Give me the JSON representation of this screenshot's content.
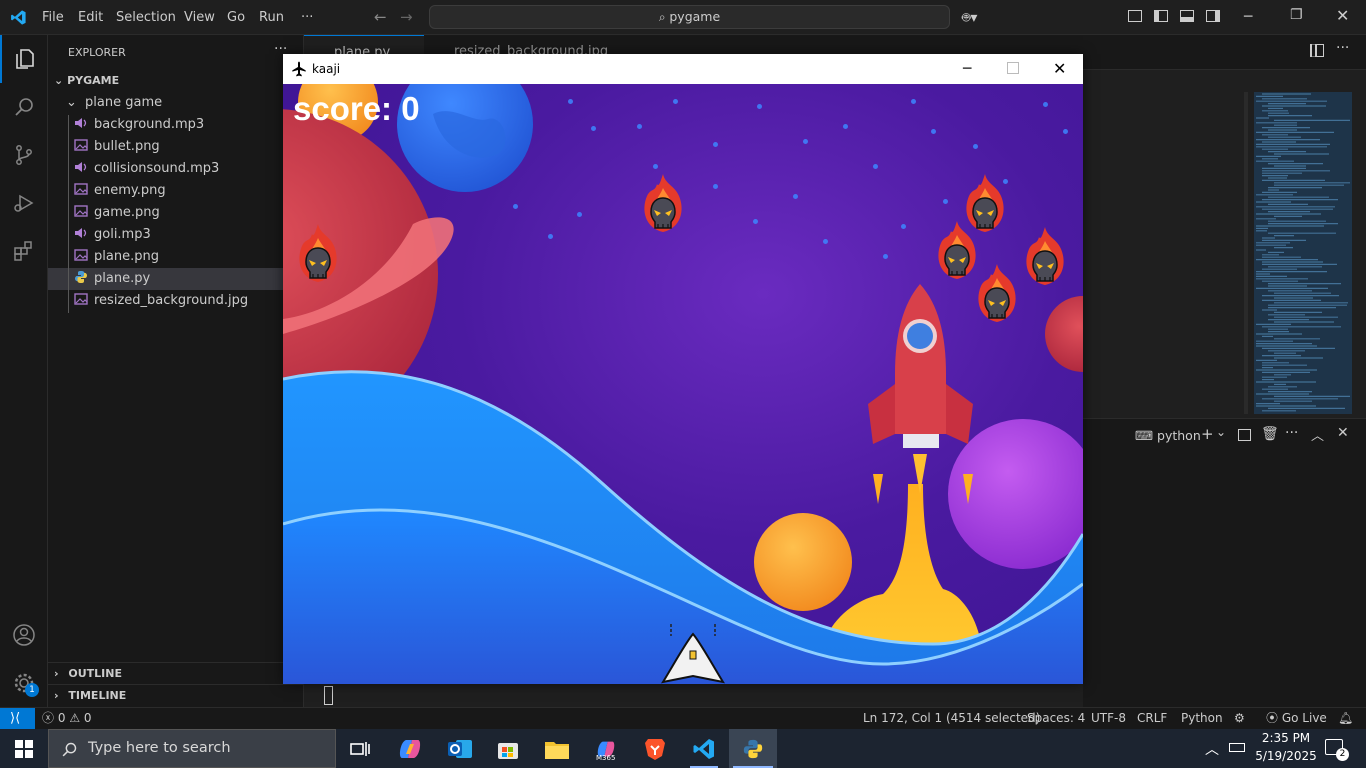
{
  "titlebar": {
    "menu": [
      "File",
      "Edit",
      "Selection",
      "View",
      "Go",
      "Run",
      "···"
    ],
    "search": "pygame"
  },
  "explorer": {
    "header": "EXPLORER",
    "workspace": "PYGAME",
    "folder": "plane game",
    "files": [
      {
        "name": "background.mp3",
        "kind": "audio"
      },
      {
        "name": "bullet.png",
        "kind": "image"
      },
      {
        "name": "collisionsound.mp3",
        "kind": "audio"
      },
      {
        "name": "enemy.png",
        "kind": "image"
      },
      {
        "name": "game.png",
        "kind": "image"
      },
      {
        "name": "goli.mp3",
        "kind": "audio"
      },
      {
        "name": "plane.png",
        "kind": "image"
      },
      {
        "name": "plane.py",
        "kind": "python",
        "selected": true
      },
      {
        "name": "resized_background.jpg",
        "kind": "image"
      }
    ],
    "outline": "OUTLINE",
    "timeline": "TIMELINE"
  },
  "tabs": [
    "plane.py",
    "resized_background.jpg"
  ],
  "panel": {
    "terminal_name": "python"
  },
  "statusbar": {
    "problems": "0",
    "warnings": "0",
    "position": "Ln 172, Col 1 (4514 selected)",
    "spaces": "Spaces: 4",
    "encoding": "UTF-8",
    "eol": "CRLF",
    "language": "Python",
    "golive": "Go Live"
  },
  "game": {
    "window_title": "kaaji",
    "score_text": "score: 0"
  },
  "taskbar": {
    "search_placeholder": "Type here to search",
    "time": "2:35 PM",
    "date": "5/19/2025",
    "notifications": "2",
    "m365_label": "M365",
    "settings_badge": "1"
  },
  "colors": {
    "accent": "#0078d4",
    "sky": "#4a1aa0",
    "wave": "#1e8fff",
    "score": "#ffffff"
  }
}
